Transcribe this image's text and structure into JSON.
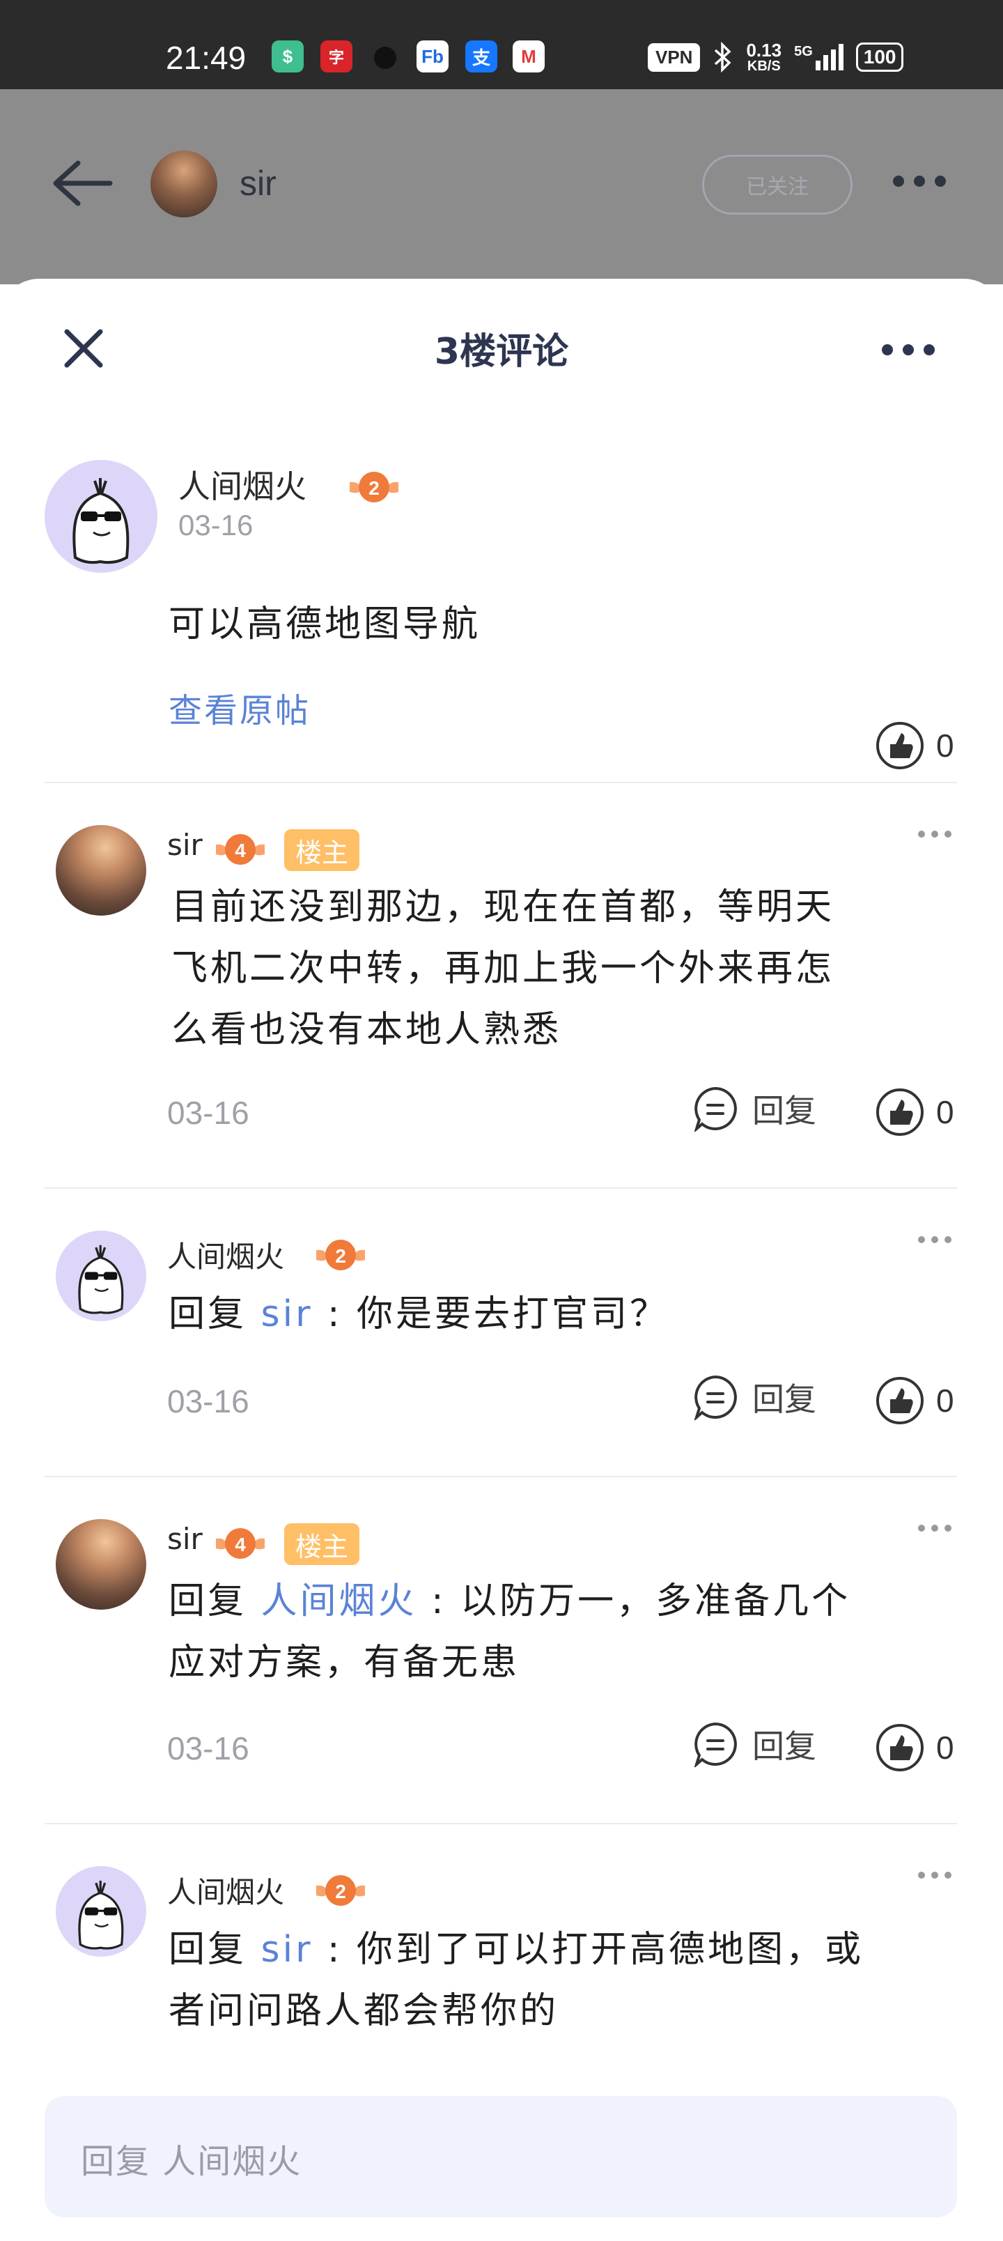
{
  "status_bar": {
    "time": "21:49",
    "vpn": "VPN",
    "net_speed_value": "0.13",
    "net_speed_unit": "KB/S",
    "signal": "5G",
    "battery": "100",
    "app_icons": [
      {
        "name": "shield-app-icon",
        "color": "#3fbf8f",
        "glyph": "$"
      },
      {
        "name": "red-app-icon",
        "color": "#d9252a",
        "glyph": "字"
      },
      {
        "name": "black-app-icon",
        "color": "#2b2b2b",
        "glyph": "●"
      },
      {
        "name": "fb-app-icon",
        "color": "#1e6be0",
        "glyph": "Fb"
      },
      {
        "name": "alipay-app-icon",
        "color": "#1677ff",
        "glyph": "支"
      },
      {
        "name": "bank-app-icon",
        "color": "#e33b3b",
        "glyph": "M"
      }
    ]
  },
  "header": {
    "name": "sir",
    "follow_label": "已关注"
  },
  "sheet": {
    "title": "3楼评论"
  },
  "main_comment": {
    "name": "人间烟火",
    "level": "2",
    "date": "03-16",
    "text": "可以高德地图导航",
    "view_original": "查看原帖",
    "likes": "0"
  },
  "replies": [
    {
      "name": "sir",
      "level": "4",
      "owner_tag": "楼主",
      "lines": [
        "目前还没到那边，现在在首都，等明天",
        "飞机二次中转，再加上我一个外来再怎",
        "么看也没有本地人熟悉"
      ],
      "date": "03-16",
      "reply_label": "回复",
      "likes": "0"
    },
    {
      "name": "人间烟火",
      "level": "2",
      "prefix": "回复 ",
      "target": "sir",
      "text": " : 你是要去打官司？",
      "date": "03-16",
      "reply_label": "回复",
      "likes": "0"
    },
    {
      "name": "sir",
      "level": "4",
      "owner_tag": "楼主",
      "prefix": "回复 ",
      "target": "人间烟火",
      "text": " : 以防万一，多准备几个",
      "line2": "应对方案，有备无患",
      "date": "03-16",
      "reply_label": "回复",
      "likes": "0"
    },
    {
      "name": "人间烟火",
      "level": "2",
      "prefix": "回复 ",
      "target": "sir",
      "text": " : 你到了可以打开高德地图，或",
      "line2": "者问问路人都会帮你的"
    }
  ],
  "reply_input": {
    "placeholder": "回复 人间烟火"
  }
}
